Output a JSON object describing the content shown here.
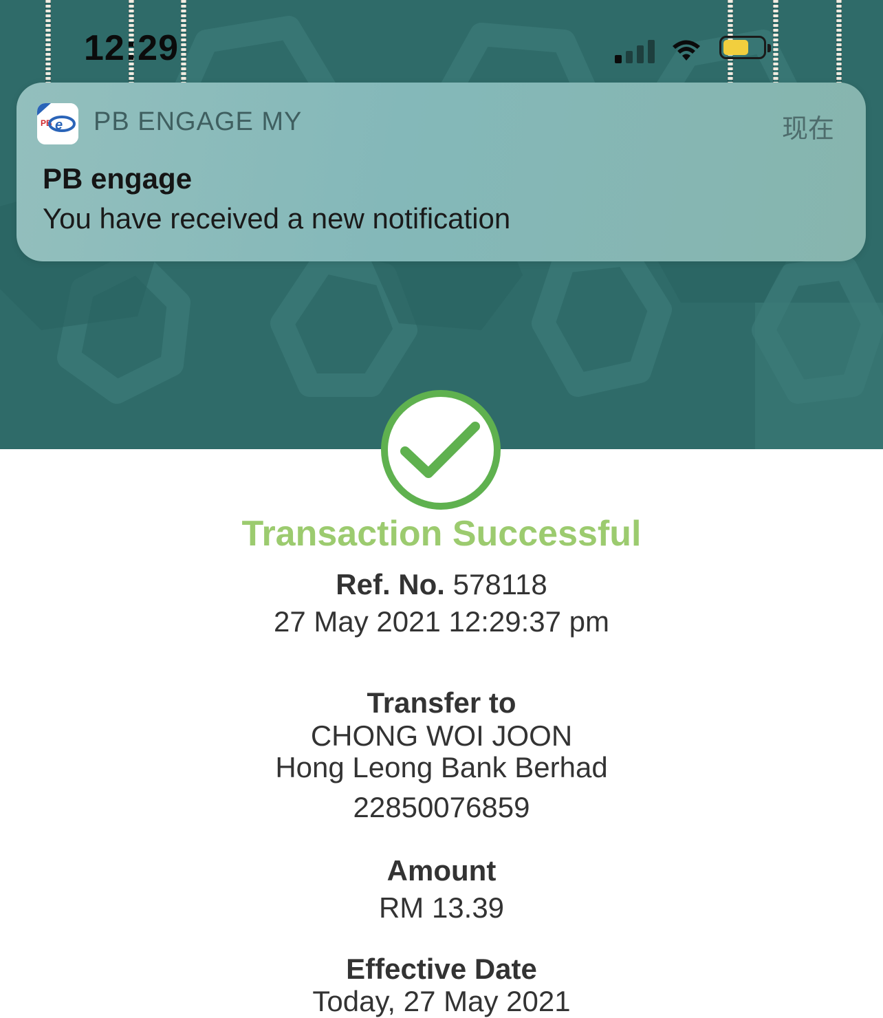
{
  "status_bar": {
    "time": "12:29"
  },
  "notification": {
    "app_name": "PB ENGAGE MY",
    "time": "现在",
    "title": "PB engage",
    "body": "You have received a new notification"
  },
  "receipt": {
    "status_title": "Transaction Successful",
    "ref_label": "Ref. No.",
    "ref_number": "578118",
    "datetime": "27 May 2021 12:29:37 pm",
    "transfer_label": "Transfer to",
    "recipient_name": "CHONG WOI JOON",
    "bank_name": "Hong Leong Bank Berhad",
    "account_number": "22850076859",
    "amount_label": "Amount",
    "amount_value": "RM 13.39",
    "effective_label": "Effective Date",
    "effective_value": "Today, 27 May 2021"
  },
  "colors": {
    "header_bg": "#2f6b69",
    "success_green": "#5fb14f",
    "title_green": "#9ccb6f",
    "battery_yellow": "#f2cf3e"
  },
  "icons": [
    "signal-icon",
    "wifi-icon",
    "battery-icon",
    "pb-engage-app-icon",
    "success-check-icon"
  ]
}
